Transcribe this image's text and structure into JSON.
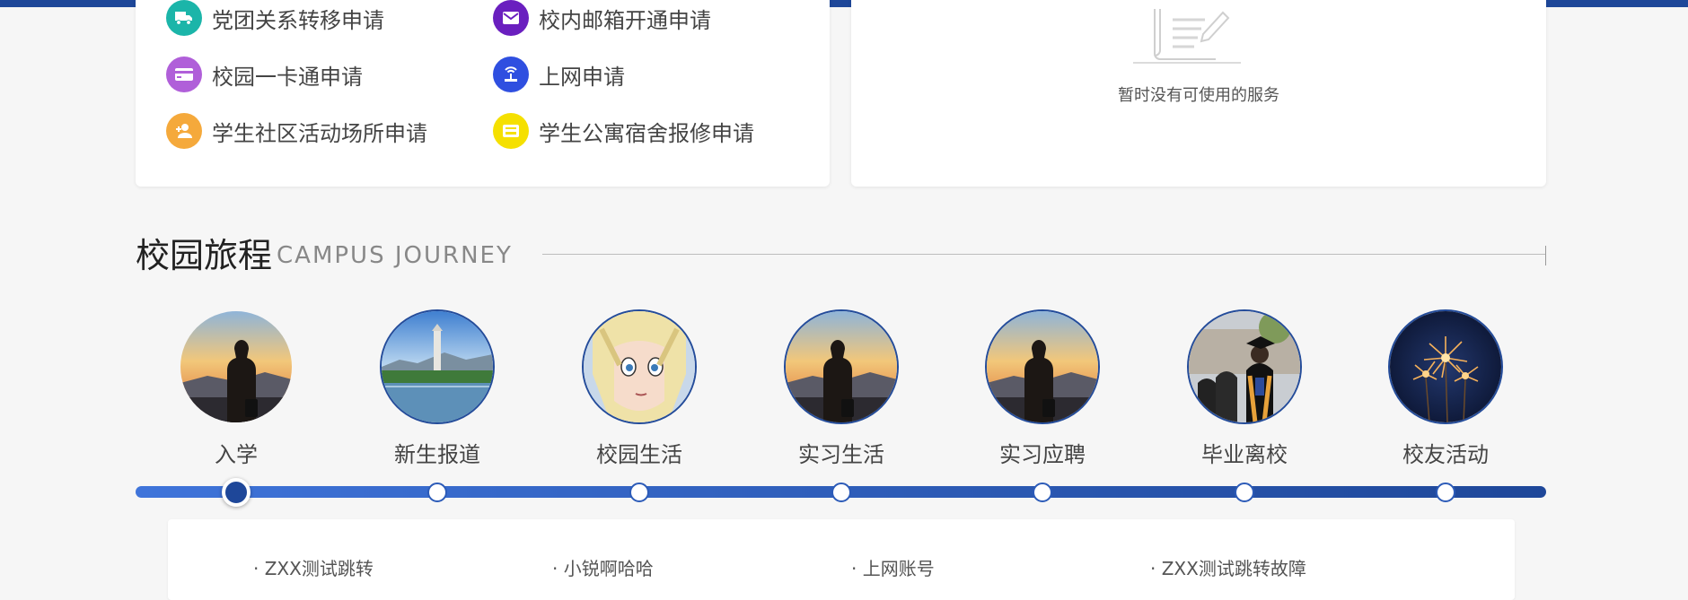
{
  "services": [
    {
      "label": "党团关系转移申请",
      "icon": "truck-icon",
      "color": "#1bb5a9"
    },
    {
      "label": "校内邮箱开通申请",
      "icon": "mail-icon",
      "color": "#6a1fbf"
    },
    {
      "label": "校园一卡通申请",
      "icon": "card-icon",
      "color": "#b05fd9"
    },
    {
      "label": "上网申请",
      "icon": "network-icon",
      "color": "#2f4fe0"
    },
    {
      "label": "学生社区活动场所申请",
      "icon": "person-add-icon",
      "color": "#f5a93b"
    },
    {
      "label": "学生公寓宿舍报修申请",
      "icon": "wrench-box-icon",
      "color": "#f5e000"
    }
  ],
  "empty_state": {
    "text": "暂时没有可使用的服务",
    "icon": "document-pen-icon"
  },
  "journey": {
    "title": "校园旅程",
    "subtitle": "CAMPUS JOURNEY",
    "stages": [
      {
        "label": "入学",
        "image": "silhouette-sunset"
      },
      {
        "label": "新生报道",
        "image": "campus-lake"
      },
      {
        "label": "校园生活",
        "image": "anime-face"
      },
      {
        "label": "实习生活",
        "image": "silhouette-sunset"
      },
      {
        "label": "实习应聘",
        "image": "silhouette-sunset"
      },
      {
        "label": "毕业离校",
        "image": "graduates"
      },
      {
        "label": "校友活动",
        "image": "fireworks"
      }
    ],
    "active_stage": 0
  },
  "links": [
    "· ZXX测试跳转",
    "· 小锐啊哈哈",
    "· 上网账号",
    "· ZXX测试跳转故障"
  ],
  "colors": {
    "accent": "#1e4799",
    "track_start": "#3f74da",
    "track_end": "#1e4799"
  }
}
